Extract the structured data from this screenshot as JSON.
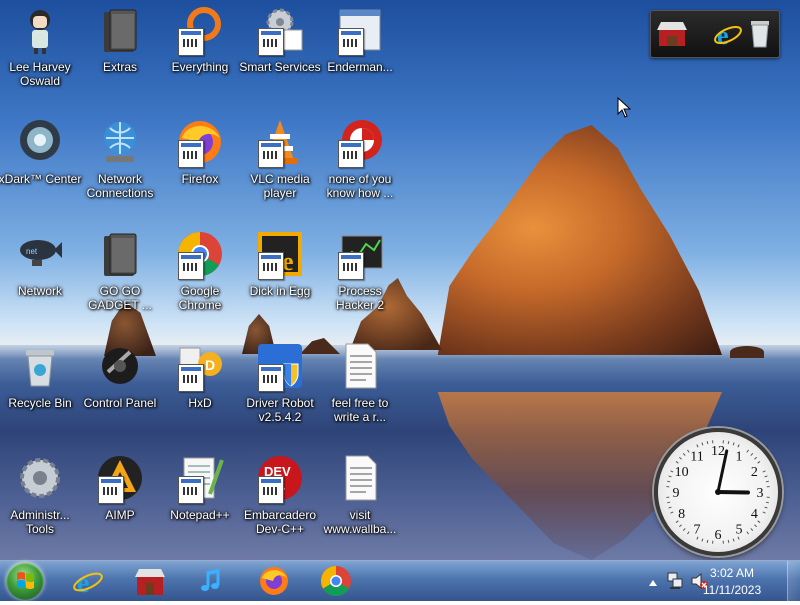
{
  "desktop": {
    "icons": [
      {
        "label": "Lee Harvey\nOswald",
        "icon": "anime-character-icon"
      },
      {
        "label": "Extras",
        "icon": "folder-icon"
      },
      {
        "label": "Everything",
        "icon": "everything-search-icon"
      },
      {
        "label": "Smart Services",
        "icon": "gears-icon"
      },
      {
        "label": "Enderman...",
        "icon": "window-icon"
      },
      {
        "label": "xDark™ Center",
        "icon": "xdark-icon"
      },
      {
        "label": "Network\nConnections",
        "icon": "network-globe-icon"
      },
      {
        "label": "Firefox",
        "icon": "firefox-icon"
      },
      {
        "label": "VLC media\nplayer",
        "icon": "vlc-cone-icon"
      },
      {
        "label": "none of you\nknow how ...",
        "icon": "red-circle-icon"
      },
      {
        "label": "Network",
        "icon": "blimp-icon"
      },
      {
        "label": "GO GO\nGADGET ...",
        "icon": "folder-icon"
      },
      {
        "label": "Google\nChrome",
        "icon": "chrome-icon"
      },
      {
        "label": "Dick in Egg",
        "icon": "yellow-game-icon"
      },
      {
        "label": "Process\nHacker 2",
        "icon": "process-monitor-icon"
      },
      {
        "label": "Recycle Bin",
        "icon": "recycle-bin-icon"
      },
      {
        "label": "Control Panel",
        "icon": "control-panel-icon"
      },
      {
        "label": "HxD",
        "icon": "hex-editor-icon"
      },
      {
        "label": "Driver Robot\nv2.5.4.2",
        "icon": "shield-icon"
      },
      {
        "label": "feel free to\nwrite a r...",
        "icon": "text-document-icon"
      },
      {
        "label": "Administr...\nTools",
        "icon": "admin-tools-icon"
      },
      {
        "label": "AIMP",
        "icon": "aimp-icon"
      },
      {
        "label": "Notepad++",
        "icon": "notepad-icon"
      },
      {
        "label": "Embarcadero\nDev-C++",
        "icon": "devcpp-icon"
      },
      {
        "label": "visit\nwww.wallba...",
        "icon": "text-document-icon"
      }
    ]
  },
  "gadgets": {
    "launcher_icons": [
      "store-icon",
      "internet-explorer-icon",
      "recycle-bin-icon"
    ],
    "clock": {
      "hour": 3,
      "minute": 2
    }
  },
  "taskbar": {
    "start_icon": "windows-orb-icon",
    "pinned": [
      "internet-explorer-icon",
      "store-icon",
      "music-note-icon",
      "firefox-icon",
      "chrome-icon"
    ],
    "tray": {
      "icons": [
        "show-hidden-icons-arrow",
        "network-icon",
        "volume-muted-icon"
      ],
      "time": "3:02 AM",
      "date": "11/11/2023"
    }
  },
  "colors": {
    "taskbar": "#4a74b0",
    "label_text": "#ffffff",
    "sky_top": "#1d4f9e"
  }
}
